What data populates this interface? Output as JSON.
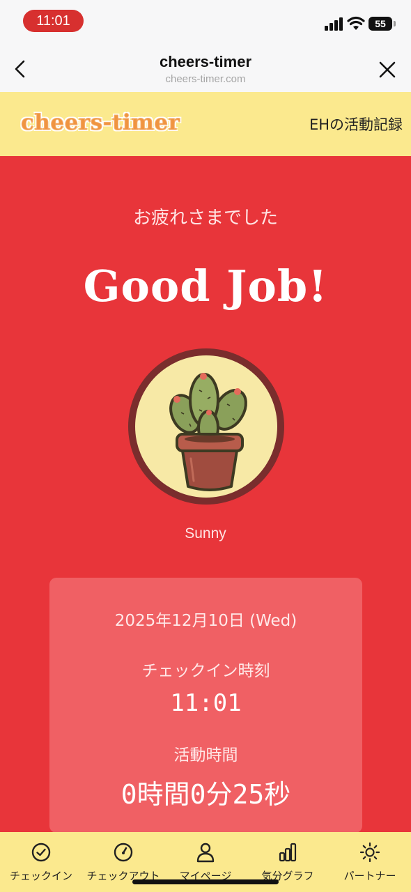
{
  "status_bar": {
    "time": "11:01",
    "battery": "55",
    "icons": [
      "signal-icon",
      "wifi-icon",
      "battery-icon"
    ]
  },
  "browser": {
    "title": "cheers-timer",
    "url": "cheers-timer.com",
    "back_icon": "chevron-left-icon",
    "close_icon": "close-icon"
  },
  "app_header": {
    "logo": "cheers-timer",
    "records_link": "EHの活動記録"
  },
  "main": {
    "greeting": "お疲れさまでした",
    "headline": "Good Job!",
    "partner_image": "cactus-in-pot",
    "partner_name": "Sunny"
  },
  "summary": {
    "date": "2025年12月10日 (Wed)",
    "checkin_label": "チェックイン時刻",
    "checkin_time": "11:01",
    "duration_label": "活動時間",
    "duration_value": "0時間0分25秒"
  },
  "bottom_nav": {
    "tabs": [
      {
        "label": "チェックイン",
        "icon": "check-circle-icon"
      },
      {
        "label": "チェックアウト",
        "icon": "gauge-icon"
      },
      {
        "label": "マイページ",
        "icon": "person-icon"
      },
      {
        "label": "気分グラフ",
        "icon": "bar-chart-icon"
      },
      {
        "label": "パートナー",
        "icon": "sun-icon"
      }
    ]
  },
  "colors": {
    "main_bg": "#e8353a",
    "header_bg": "#fbe98e",
    "card_bg": "#f06064",
    "logo_orange": "#f09440"
  }
}
